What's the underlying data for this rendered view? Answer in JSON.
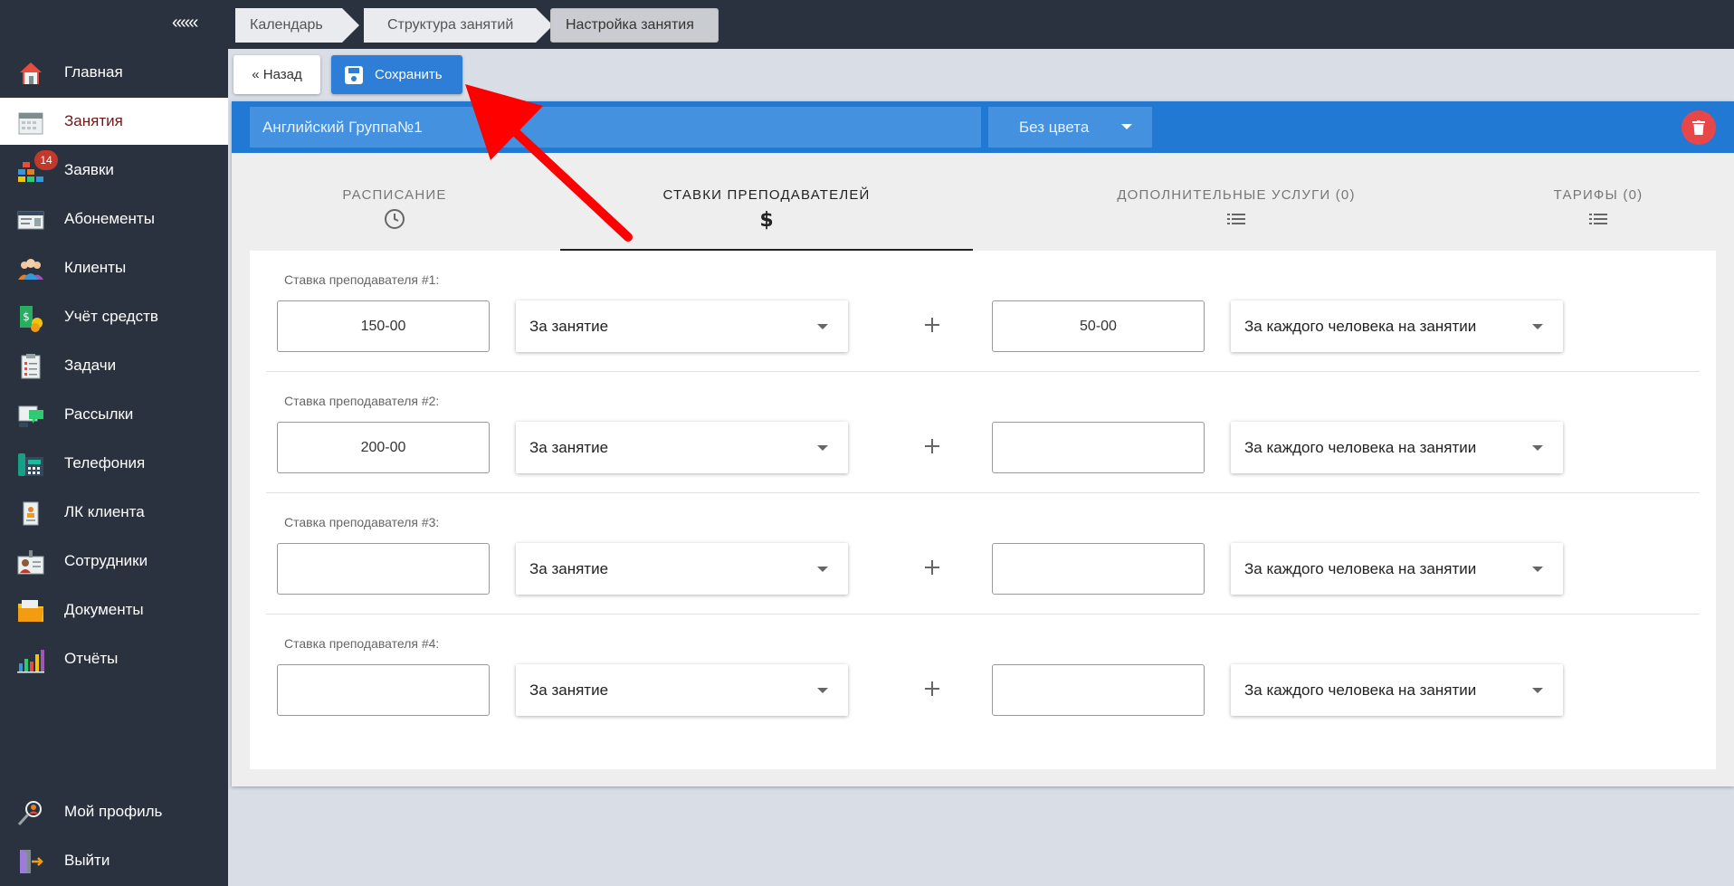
{
  "sidebar": {
    "collapse_label": "«««",
    "items": [
      {
        "label": "Главная",
        "icon": "home-icon"
      },
      {
        "label": "Занятия",
        "icon": "calendar-icon",
        "active": true
      },
      {
        "label": "Заявки",
        "icon": "requests-icon",
        "badge": "14"
      },
      {
        "label": "Абонементы",
        "icon": "membership-card-icon"
      },
      {
        "label": "Клиенты",
        "icon": "clients-icon"
      },
      {
        "label": "Учёт средств",
        "icon": "money-icon"
      },
      {
        "label": "Задачи",
        "icon": "tasks-icon"
      },
      {
        "label": "Рассылки",
        "icon": "mailing-icon"
      },
      {
        "label": "Телефония",
        "icon": "phone-icon"
      },
      {
        "label": "ЛК клиента",
        "icon": "client-account-icon"
      },
      {
        "label": "Сотрудники",
        "icon": "staff-icon"
      },
      {
        "label": "Документы",
        "icon": "documents-icon"
      },
      {
        "label": "Отчёты",
        "icon": "reports-icon"
      }
    ],
    "bottom_items": [
      {
        "label": "Мой профиль",
        "icon": "profile-icon"
      },
      {
        "label": "Выйти",
        "icon": "logout-icon"
      }
    ]
  },
  "breadcrumb": [
    "Календарь",
    "Структура занятий",
    "Настройка занятия"
  ],
  "toolbar": {
    "back_label": "« Назад",
    "save_label": "Сохранить"
  },
  "lesson": {
    "name": "Английский Группа№1",
    "color_select": "Без цвета"
  },
  "tabs": [
    {
      "label": "РАСПИСАНИЕ",
      "icon": "clock-icon"
    },
    {
      "label": "СТАВКИ ПРЕПОДАВАТЕЛЕЙ",
      "icon": "dollar-icon",
      "active": true
    },
    {
      "label": "ДОПОЛНИТЕЛЬНЫЕ УСЛУГИ (0)",
      "icon": "list-icon"
    },
    {
      "label": "ТАРИФЫ (0)",
      "icon": "list-icon"
    }
  ],
  "rates": [
    {
      "label": "Ставка преподавателя #1:",
      "base": "150-00",
      "base_unit": "За занятие",
      "extra": "50-00",
      "extra_unit": "За каждого человека на занятии"
    },
    {
      "label": "Ставка преподавателя #2:",
      "base": "200-00",
      "base_unit": "За занятие",
      "extra": "",
      "extra_unit": "За каждого человека на занятии"
    },
    {
      "label": "Ставка преподавателя #3:",
      "base": "",
      "base_unit": "За занятие",
      "extra": "",
      "extra_unit": "За каждого человека на занятии"
    },
    {
      "label": "Ставка преподавателя #4:",
      "base": "",
      "base_unit": "За занятие",
      "extra": "",
      "extra_unit": "За каждого человека на занятии"
    }
  ],
  "colors": {
    "sidebar": "#2a3240",
    "accent": "#2179d4",
    "save": "#2e7dd7",
    "delete": "#e8474a",
    "annotation": "#ff0000"
  }
}
